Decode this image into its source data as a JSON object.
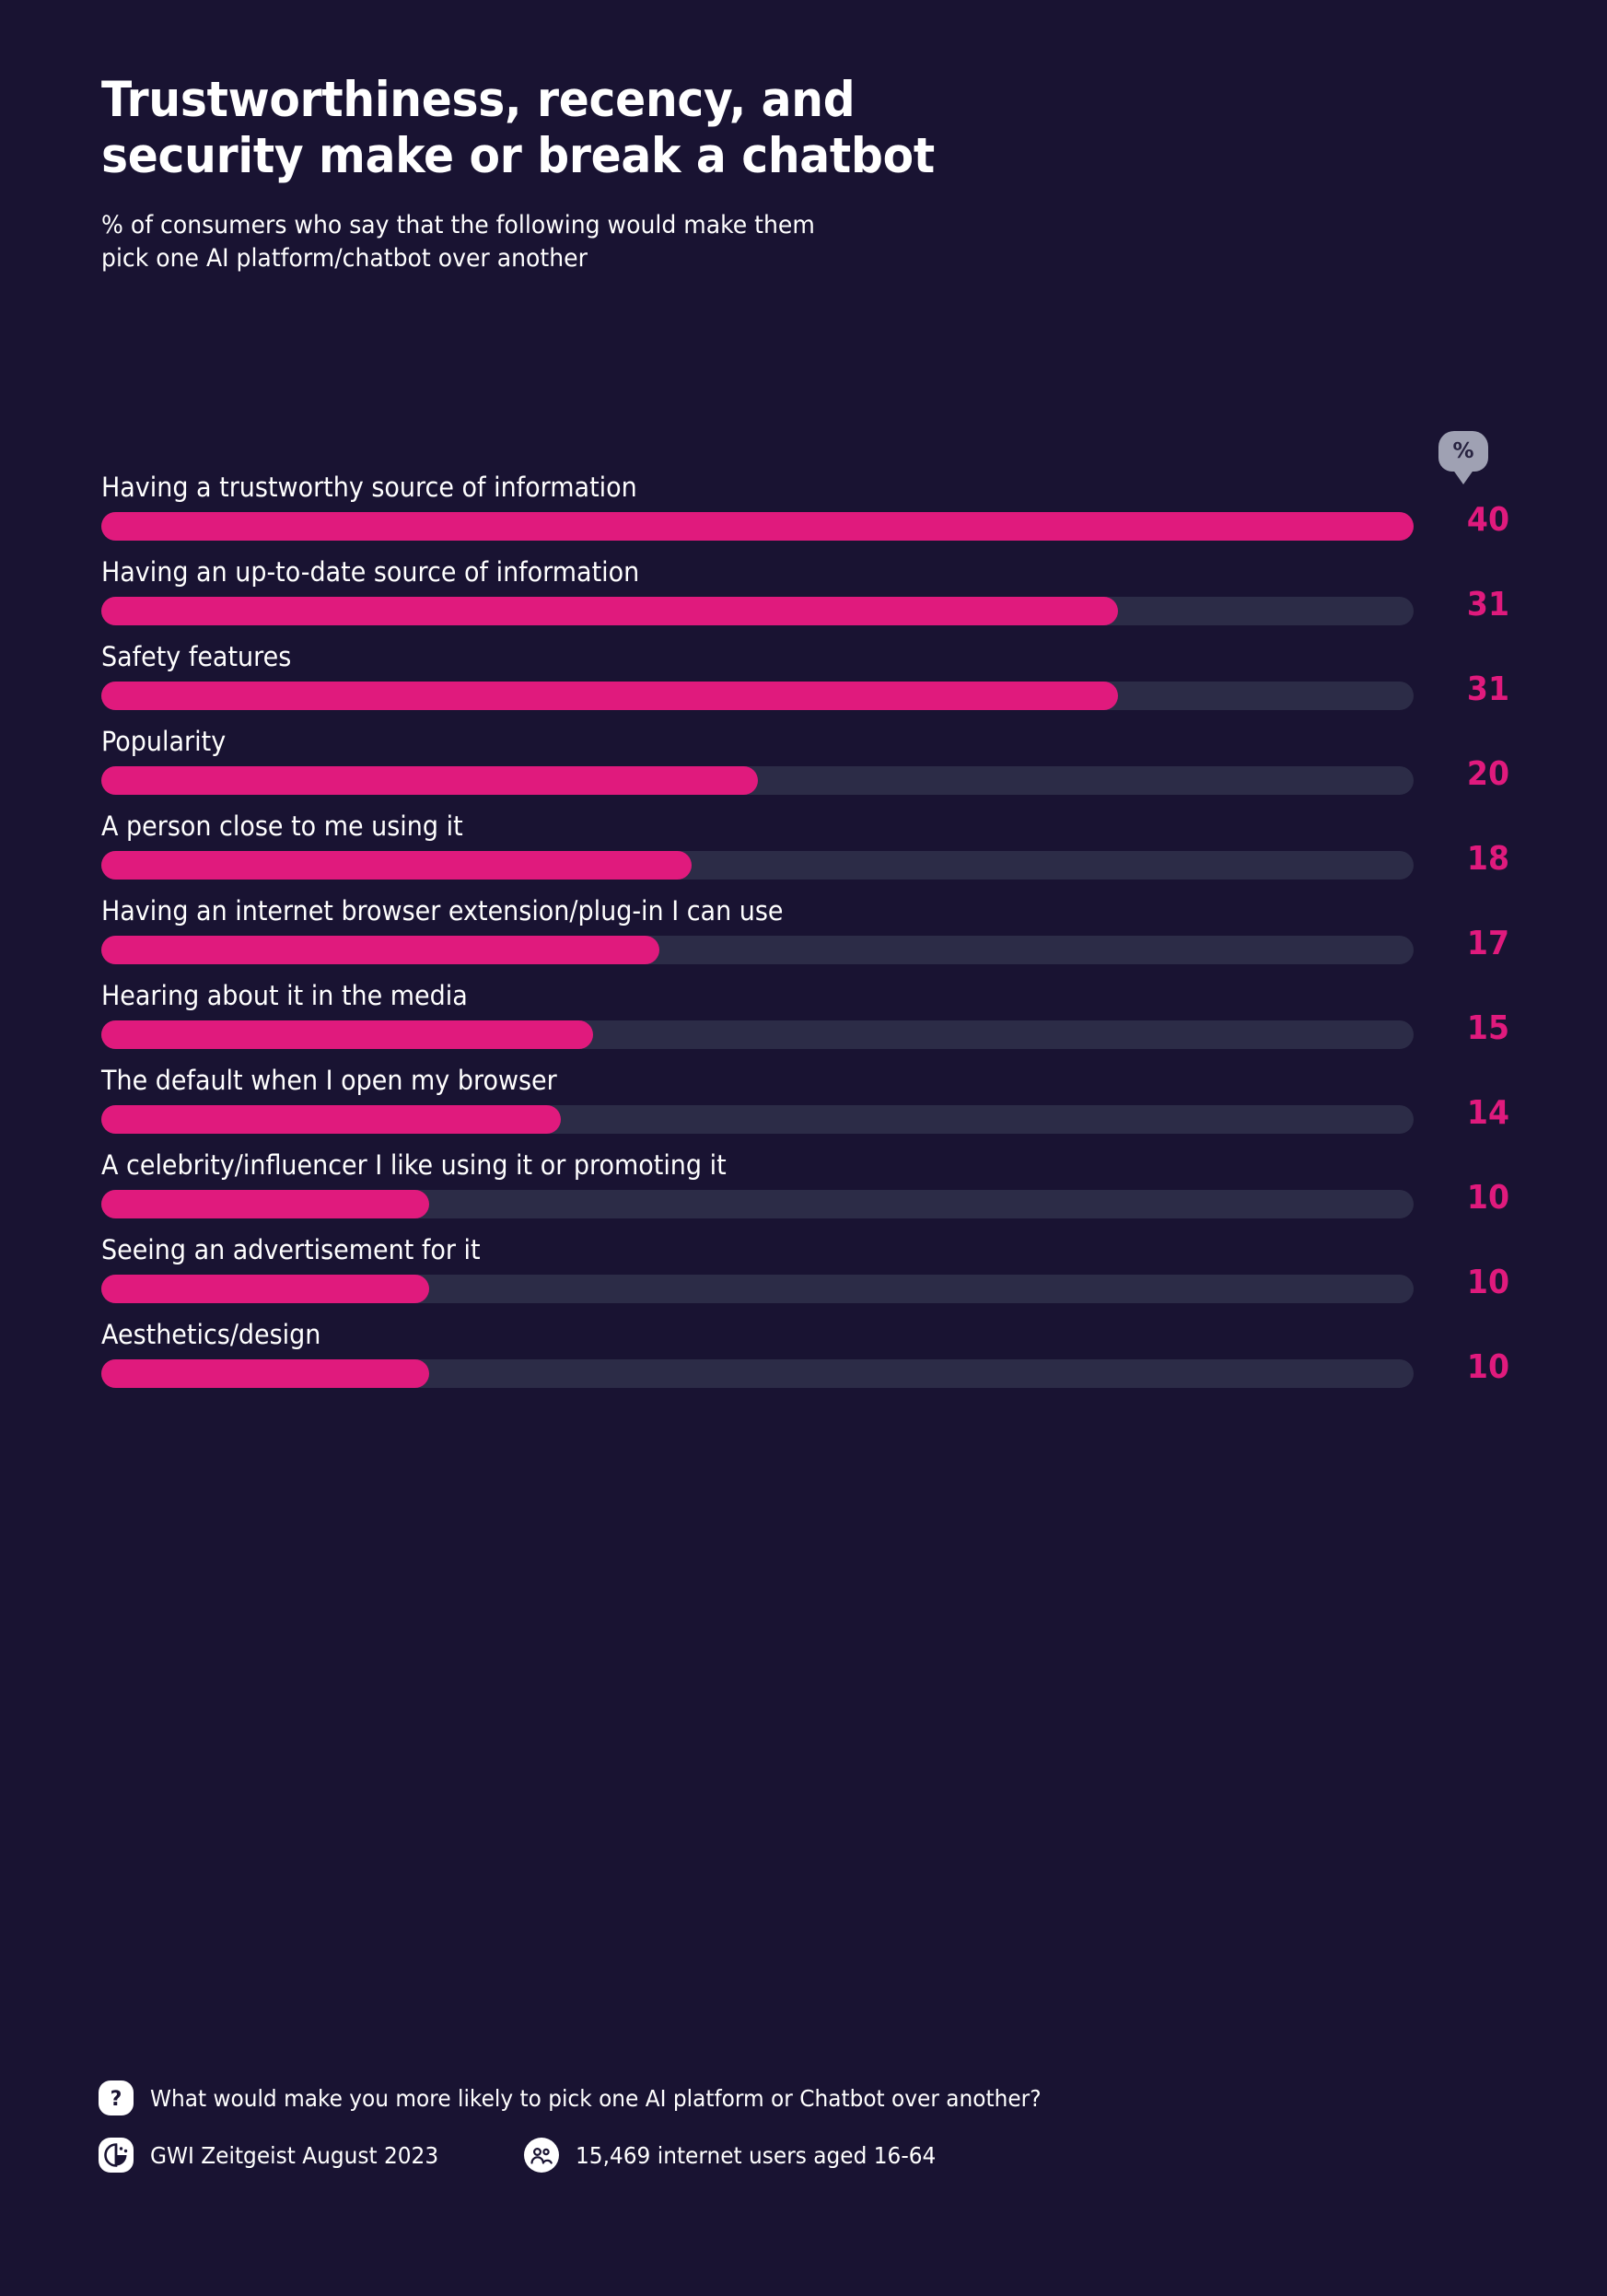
{
  "title": "Trustworthiness, recency, and\nsecurity make or break a chatbot",
  "subtitle": "% of consumers who say that the following would make them\npick one AI platform/chatbot over another",
  "percent_badge": {
    "label": "%",
    "icon": "percent-badge-icon",
    "color": "#9fa1b3"
  },
  "colors": {
    "background": "#191332",
    "bar_fill": "#e01a7d",
    "bar_track": "#2c2c47",
    "text": "#ffffff",
    "value_text": "#e01a7d"
  },
  "footer": {
    "question_icon": "question-mark-icon",
    "question": "What would make you more likely to pick one AI platform or Chatbot over another?",
    "source_icon": "gwi-logo-icon",
    "source": "GWI Zeitgeist August 2023",
    "audience_icon": "people-icon",
    "audience": "15,469 internet users aged 16-64"
  },
  "chart_data": {
    "type": "bar",
    "orientation": "horizontal",
    "title": "Trustworthiness, recency, and security make or break a chatbot",
    "subtitle": "% of consumers who say that the following would make them pick one AI platform/chatbot over another",
    "xlabel": "",
    "ylabel": "",
    "unit": "%",
    "xlim": [
      0,
      40
    ],
    "grid": false,
    "legend": "none",
    "categories": [
      "Having a trustworthy source of information",
      "Having an up-to-date source of information",
      "Safety features",
      "Popularity",
      "A person close to me using it",
      "Having an internet browser extension/plug-in I can use",
      "Hearing about it in the media",
      "The default when I open my browser",
      "A celebrity/influencer I like using it or promoting it",
      "Seeing an advertisement for it",
      "Aesthetics/design"
    ],
    "values": [
      40,
      31,
      31,
      20,
      18,
      17,
      15,
      14,
      10,
      10,
      10
    ],
    "value_labels": [
      "40",
      "31",
      "31",
      "20",
      "18",
      "17",
      "15",
      "14",
      "10",
      "10",
      "10"
    ]
  }
}
